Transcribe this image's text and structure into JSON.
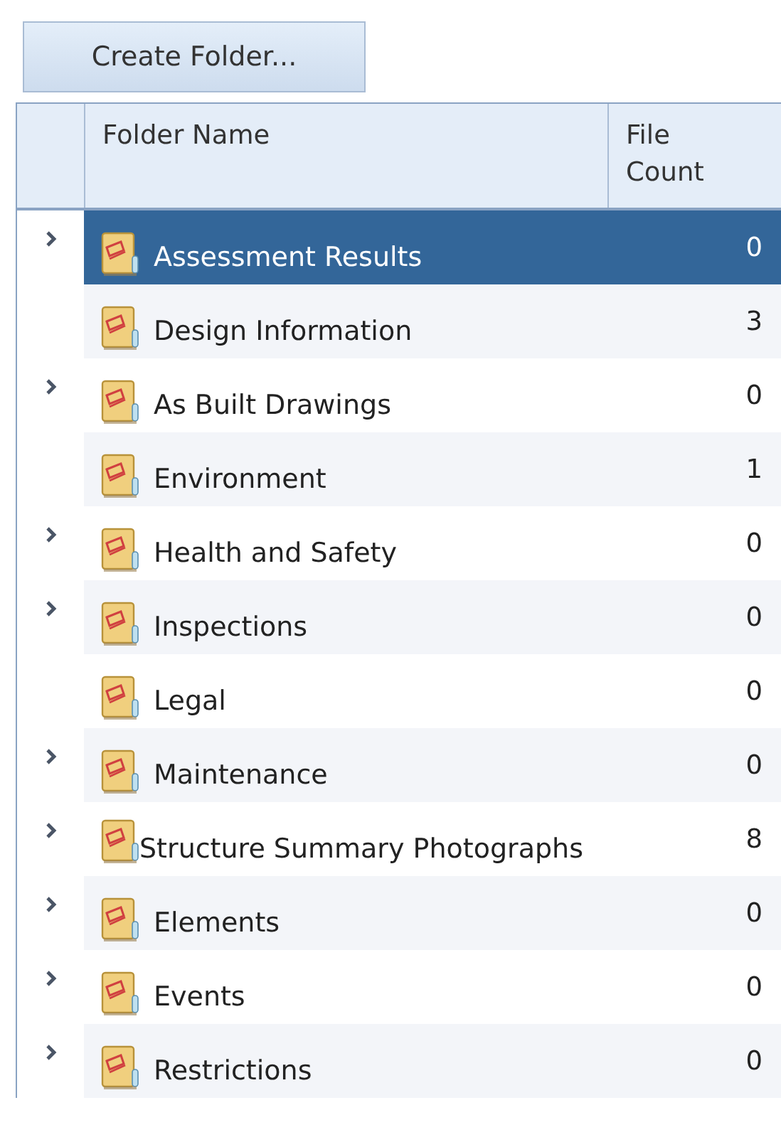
{
  "toolbar": {
    "create_button": "Create Folder..."
  },
  "table": {
    "columns": [
      "Folder Name",
      "File Count"
    ],
    "rows": [
      {
        "name": "Assessment Results",
        "count": "0",
        "expandable": true,
        "selected": true
      },
      {
        "name": "Design Information",
        "count": "3",
        "expandable": false,
        "selected": false
      },
      {
        "name": "As Built Drawings",
        "count": "0",
        "expandable": true,
        "selected": false
      },
      {
        "name": "Environment",
        "count": "1",
        "expandable": false,
        "selected": false
      },
      {
        "name": "Health and Safety",
        "count": "0",
        "expandable": true,
        "selected": false
      },
      {
        "name": "Inspections",
        "count": "0",
        "expandable": true,
        "selected": false
      },
      {
        "name": "Legal",
        "count": "0",
        "expandable": false,
        "selected": false
      },
      {
        "name": "Maintenance",
        "count": "0",
        "expandable": true,
        "selected": false
      },
      {
        "name": "Structure Summary Photographs",
        "count": "8",
        "expandable": true,
        "selected": false
      },
      {
        "name": "Elements",
        "count": "0",
        "expandable": true,
        "selected": false
      },
      {
        "name": "Events",
        "count": "0",
        "expandable": true,
        "selected": false
      },
      {
        "name": "Restrictions",
        "count": "0",
        "expandable": true,
        "selected": false
      }
    ]
  }
}
